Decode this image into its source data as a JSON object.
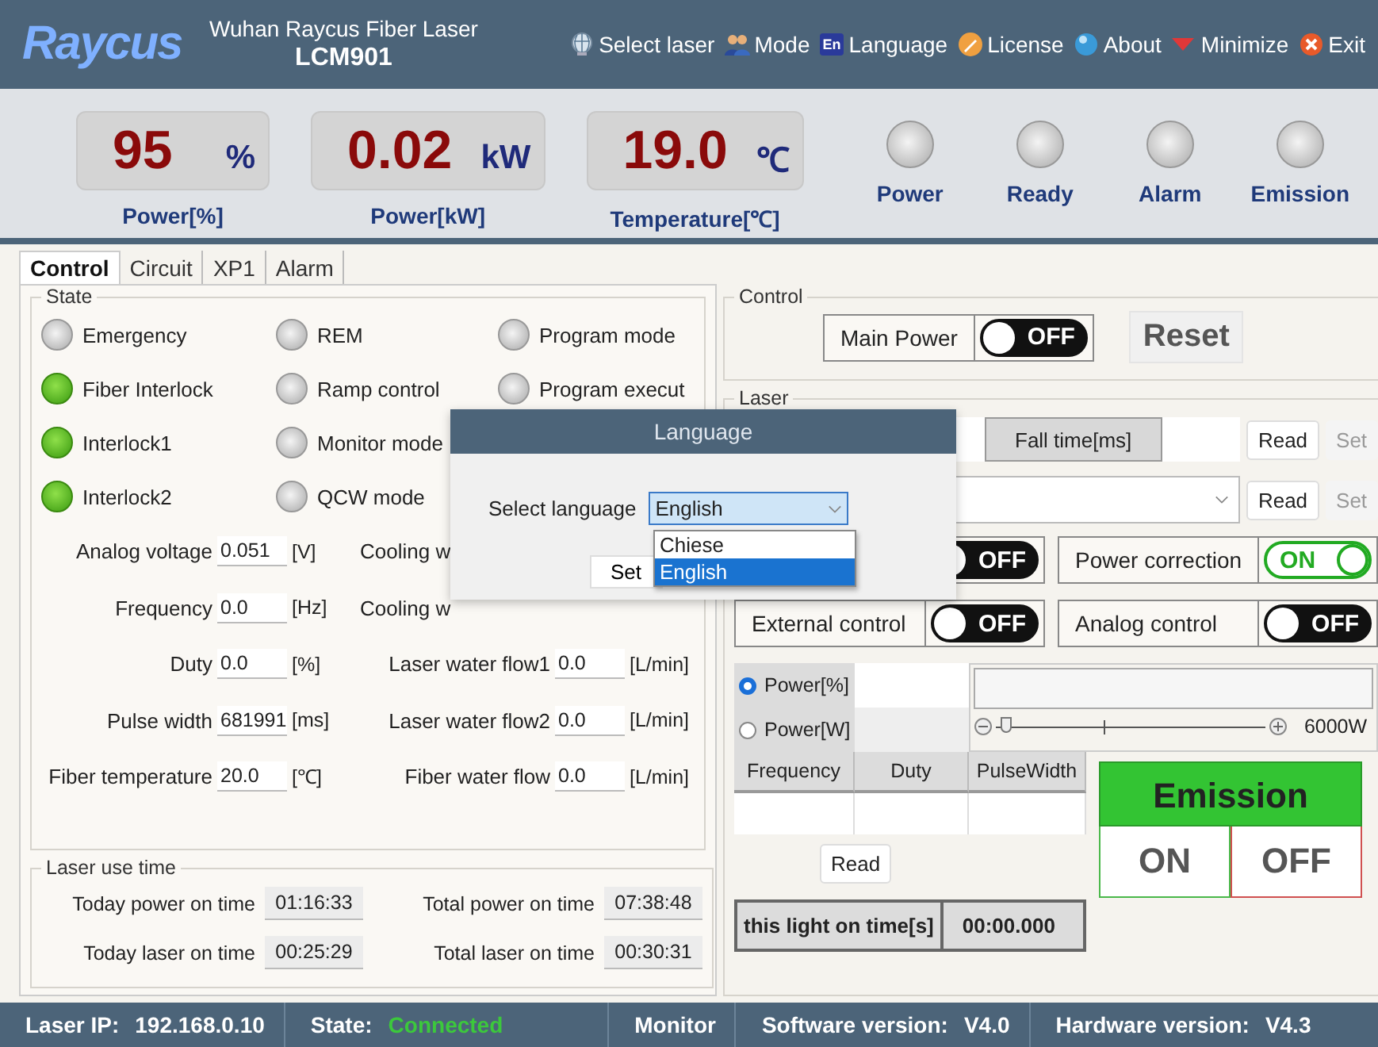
{
  "header": {
    "logo": "Raycus",
    "company": "Wuhan Raycus Fiber Laser",
    "model": "LCM901",
    "menu": [
      {
        "label": "Select laser"
      },
      {
        "label": "Mode"
      },
      {
        "label": "Language",
        "badge": "En"
      },
      {
        "label": "License"
      },
      {
        "label": "About"
      },
      {
        "label": "Minimize"
      },
      {
        "label": "Exit"
      }
    ]
  },
  "readouts": [
    {
      "value": "95",
      "unit": "%",
      "label": "Power[%]"
    },
    {
      "value": "0.02",
      "unit": "kW",
      "label": "Power[kW]"
    },
    {
      "value": "19.0",
      "unit": "℃",
      "label": "Temperature[℃]"
    }
  ],
  "lamps": [
    {
      "label": "Power",
      "on": false
    },
    {
      "label": "Ready",
      "on": false
    },
    {
      "label": "Alarm",
      "on": false
    },
    {
      "label": "Emission",
      "on": false
    }
  ],
  "tabs": [
    {
      "label": "Control",
      "selected": true
    },
    {
      "label": "Circuit",
      "selected": false
    },
    {
      "label": "XP1",
      "selected": false
    },
    {
      "label": "Alarm",
      "selected": false
    }
  ],
  "state": {
    "title": "State",
    "indicators": [
      {
        "label": "Emergency",
        "on": false
      },
      {
        "label": "Fiber Interlock",
        "on": true
      },
      {
        "label": "Interlock1",
        "on": true
      },
      {
        "label": "Interlock2",
        "on": true
      },
      {
        "label": "REM",
        "on": false
      },
      {
        "label": "Ramp control",
        "on": false
      },
      {
        "label": "Monitor mode",
        "on": false
      },
      {
        "label": "QCW mode",
        "on": false
      },
      {
        "label": "Program mode",
        "on": false
      },
      {
        "label": "Program execut",
        "on": false
      }
    ],
    "fields": [
      {
        "label": "Analog voltage",
        "value": "0.051",
        "unit": "[V]"
      },
      {
        "label": "Cooling w"
      },
      {
        "label": "Frequency",
        "value": "0.0",
        "unit": "[Hz]"
      },
      {
        "label": "Cooling w"
      },
      {
        "label": "Duty",
        "value": "0.0",
        "unit": "[%]"
      },
      {
        "label": "Laser water flow1",
        "value": "0.0",
        "unit": "[L/min]"
      },
      {
        "label": "Pulse width",
        "value": "681991",
        "unit": "[ms]"
      },
      {
        "label": "Laser water flow2",
        "value": "0.0",
        "unit": "[L/min]"
      },
      {
        "label": "Fiber temperature",
        "value": "20.0",
        "unit": "[℃]"
      },
      {
        "label": "Fiber water flow",
        "value": "0.0",
        "unit": "[L/min]"
      }
    ]
  },
  "use_time": {
    "title": "Laser use time",
    "items": [
      {
        "label": "Today power on time",
        "value": "01:16:33"
      },
      {
        "label": "Total power on time",
        "value": "07:38:48"
      },
      {
        "label": "Today laser on time",
        "value": "00:25:29"
      },
      {
        "label": "Total laser on time",
        "value": "00:30:31"
      }
    ]
  },
  "control": {
    "title": "Control",
    "main_power": {
      "label": "Main Power",
      "toggle": {
        "text": "OFF",
        "on": false
      }
    },
    "reset": "Reset"
  },
  "laser": {
    "title": "Laser",
    "rows": [
      {
        "kind": "param",
        "label": "Fall time[ms]",
        "buttons": [
          {
            "label": "Read",
            "disabled": false
          },
          {
            "label": "Set",
            "disabled": true
          }
        ]
      },
      {
        "kind": "select",
        "buttons": [
          {
            "label": "Read",
            "disabled": false
          },
          {
            "label": "Set",
            "disabled": true
          }
        ]
      }
    ],
    "switches": [
      {
        "toggle": {
          "text": "OFF",
          "on": false
        }
      },
      {
        "label": "Power correction",
        "toggle": {
          "text": "ON",
          "on": true
        }
      },
      {
        "label": "External control",
        "toggle": {
          "text": "OFF",
          "on": false
        }
      },
      {
        "label": "Analog control",
        "toggle": {
          "text": "OFF",
          "on": false
        }
      }
    ],
    "power_mode": [
      {
        "label": "Power[%]",
        "selected": true
      },
      {
        "label": "Power[W]",
        "selected": false
      }
    ],
    "slider": {
      "level": 0.04,
      "max_label": "6000W"
    },
    "pulse_table": {
      "columns": [
        "Frequency",
        "Duty",
        "PulseWidth"
      ]
    },
    "read_button": "Read",
    "emission": {
      "title": "Emission",
      "buttons": [
        "ON",
        "OFF"
      ]
    },
    "light_time": {
      "label": "this light on time[s]",
      "value": "00:00.000"
    }
  },
  "dialog": {
    "title": "Language",
    "label": "Select language",
    "value": "English",
    "options": [
      {
        "label": "Chiese",
        "selected": false
      },
      {
        "label": "English",
        "selected": true
      }
    ],
    "button": "Set"
  },
  "status_bar": [
    {
      "label": "Laser IP:",
      "value": "192.168.0.10"
    },
    {
      "label": "State:",
      "value": "Connected",
      "color": "#3cc83c"
    },
    {
      "label": "Monitor"
    },
    {
      "label": "Software version:",
      "value": "V4.0"
    },
    {
      "label": "Hardware version:",
      "value": "V4.3"
    }
  ]
}
